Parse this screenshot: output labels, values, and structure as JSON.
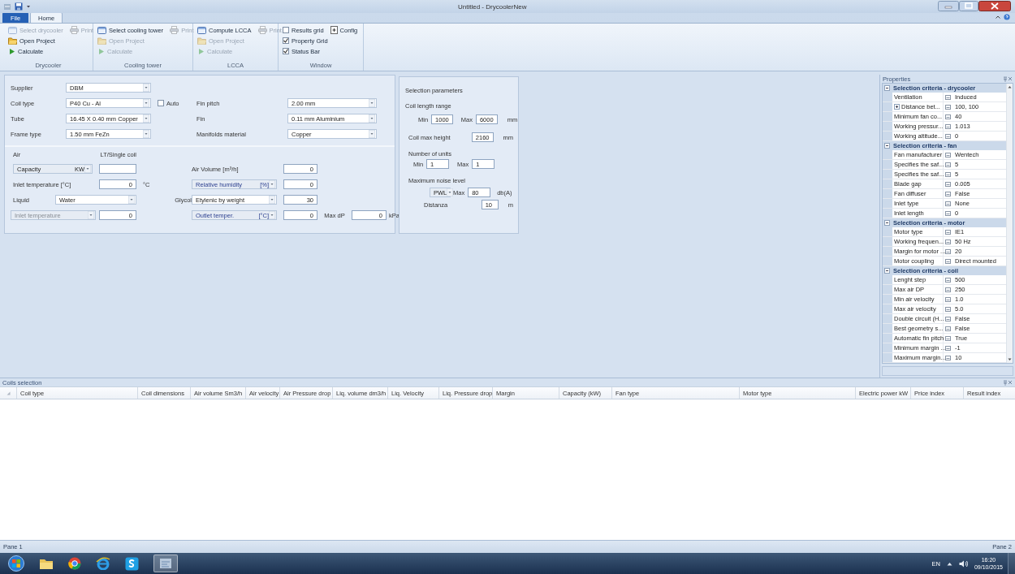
{
  "window": {
    "title": "Untitled - DrycoolerNew"
  },
  "ribbon": {
    "tabs": [
      {
        "label": "File",
        "selected": false
      },
      {
        "label": "Home",
        "selected": true
      }
    ],
    "groups": [
      {
        "label": "Drycooler",
        "rows": [
          [
            {
              "kind": "select",
              "label": "Select drycooler",
              "disabled": true
            },
            {
              "kind": "print",
              "label": "Print",
              "disabled": true
            }
          ],
          [
            {
              "kind": "open",
              "label": "Open Project",
              "disabled": false
            }
          ],
          [
            {
              "kind": "calculate",
              "label": "Calculate",
              "disabled": false
            }
          ]
        ]
      },
      {
        "label": "Cooling tower",
        "rows": [
          [
            {
              "kind": "select",
              "label": "Select cooling tower",
              "disabled": false
            },
            {
              "kind": "print",
              "label": "Print",
              "disabled": true
            }
          ],
          [
            {
              "kind": "open",
              "label": "Open Project",
              "disabled": true
            }
          ],
          [
            {
              "kind": "calculate",
              "label": "Calculate",
              "disabled": true
            }
          ]
        ]
      },
      {
        "label": "LCCA",
        "rows": [
          [
            {
              "kind": "select",
              "label": "Compute LCCA",
              "disabled": false
            },
            {
              "kind": "print",
              "label": "Print",
              "disabled": true
            }
          ],
          [
            {
              "kind": "open",
              "label": "Open Project",
              "disabled": true
            }
          ],
          [
            {
              "kind": "calculate",
              "label": "Calculate",
              "disabled": true
            }
          ]
        ]
      },
      {
        "label": "Window",
        "rows": [
          [
            {
              "kind": "check",
              "label": "Results grid",
              "checked": false,
              "disabled": false
            },
            {
              "kind": "config",
              "label": "Config",
              "disabled": false
            }
          ],
          [
            {
              "kind": "check",
              "label": "Property Grid",
              "checked": true,
              "disabled": false
            }
          ],
          [
            {
              "kind": "check",
              "label": "Status Bar",
              "checked": true,
              "disabled": false
            }
          ]
        ]
      }
    ]
  },
  "coil": {
    "supplier": {
      "label": "Supplier",
      "value": "DBM"
    },
    "left_fields": [
      {
        "label": "Coil type",
        "value": "P40 Cu - Al"
      },
      {
        "label": "Tube",
        "value": "16.45 X 0.40 mm Copper"
      },
      {
        "label": "Frame type",
        "value": "1.50 mm FeZn"
      }
    ],
    "auto": {
      "label": "Auto",
      "checked": false
    },
    "right_fields": [
      {
        "label": "Fin pitch",
        "value": "2.00 mm"
      },
      {
        "label": "Fin",
        "value": "0.11 mm Aluminium"
      },
      {
        "label": "Manifolds material",
        "value": "Copper"
      }
    ]
  },
  "conditions": {
    "air_label": "Air",
    "capacity_caption": "LT/Single coil",
    "capacity": {
      "mode": "Capacity",
      "unit": "KW"
    },
    "air_volume": {
      "label": "Air Volume [m³/h]",
      "value": "0"
    },
    "inlet_temperature": {
      "label": "Inlet temperature [°C]",
      "value": "0",
      "unit": "°C"
    },
    "relative_humidity": {
      "mode": "Relative humidity",
      "unit": "[%]",
      "value": "0"
    },
    "liquid": {
      "label": "Liquid",
      "value": "Water"
    },
    "glycol": {
      "label": "Glycol",
      "value": "Etylenic by weight",
      "amount": "30"
    },
    "liquid_inlet": {
      "mode": "Inlet temperature",
      "value": "0"
    },
    "outlet": {
      "mode": "Outlet temper.",
      "unit": "[°C]",
      "value": "0"
    },
    "max_dp": {
      "label": "Max dP",
      "value": "0",
      "unit": "kPa"
    }
  },
  "selection_parameters": {
    "title": "Selection parameters",
    "coil_length": {
      "label": "Coil length range",
      "min_label": "Min",
      "min": "1000",
      "max_label": "Max",
      "max": "6000",
      "unit": "mm"
    },
    "coil_max_height": {
      "label": "Coil max height",
      "value": "2160",
      "unit": "mm"
    },
    "units": {
      "label": "Number of units",
      "min_label": "Min",
      "min": "1",
      "max_label": "Max",
      "max": "1"
    },
    "noise": {
      "label": "Maximum noise level",
      "mode": "PWL",
      "max_label": "Max",
      "max": "80",
      "unit": "db(A)",
      "distance_label": "Distanza",
      "distance": "10",
      "distance_unit": "m"
    }
  },
  "properties": {
    "title": "Properties",
    "categories": [
      {
        "title": "Selection criteria - drycooler",
        "expanded": true,
        "rows": [
          {
            "name": "Ventilation",
            "value": "Induced",
            "expandable": false
          },
          {
            "name": "Distance bet...",
            "value": "100, 100",
            "expandable": true
          },
          {
            "name": "Minimum fan co...",
            "value": "40",
            "expandable": false
          },
          {
            "name": "Working pressur...",
            "value": "1.013",
            "expandable": false
          },
          {
            "name": "Working altitude...",
            "value": "0",
            "expandable": false
          }
        ]
      },
      {
        "title": "Selection criteria - fan",
        "expanded": true,
        "rows": [
          {
            "name": "Fan manufacturer",
            "value": "Wentech",
            "expandable": false
          },
          {
            "name": "Specifies the saf...",
            "value": "5",
            "expandable": false
          },
          {
            "name": "Specifies the saf...",
            "value": "5",
            "expandable": false
          },
          {
            "name": "Blade gap",
            "value": "0.005",
            "expandable": false
          },
          {
            "name": "Fan diffuser",
            "value": "False",
            "expandable": false
          },
          {
            "name": "Inlet type",
            "value": "None",
            "expandable": false
          },
          {
            "name": "Inlet length",
            "value": "0",
            "expandable": false
          }
        ]
      },
      {
        "title": "Selection criteria - motor",
        "expanded": true,
        "rows": [
          {
            "name": "Motor type",
            "value": "IE1",
            "expandable": false
          },
          {
            "name": "Working frequen...",
            "value": "50 Hz",
            "expandable": false
          },
          {
            "name": "Margin for motor ...",
            "value": "20",
            "expandable": false
          },
          {
            "name": "Motor coupling",
            "value": "Direct mounted",
            "expandable": false
          }
        ]
      },
      {
        "title": "Selection criteria - coil",
        "expanded": true,
        "rows": [
          {
            "name": "Lenght step",
            "value": "500",
            "expandable": false
          },
          {
            "name": "Max air DP",
            "value": "250",
            "expandable": false
          },
          {
            "name": "Min air velocity",
            "value": "1.0",
            "expandable": false
          },
          {
            "name": "Max air velocity",
            "value": "5.0",
            "expandable": false
          },
          {
            "name": "Double circuit (H...",
            "value": "False",
            "expandable": false
          },
          {
            "name": "Best geometry s...",
            "value": "False",
            "expandable": false
          },
          {
            "name": "Automatic fin pitch",
            "value": "True",
            "expandable": false
          },
          {
            "name": "Minimum margin ...",
            "value": "-1",
            "expandable": false
          },
          {
            "name": "Maximum margin...",
            "value": "10",
            "expandable": false
          }
        ]
      }
    ]
  },
  "coils_selection": {
    "title": "Coils selection",
    "columns": [
      "Coil type",
      "Coil dimensions",
      "Air volume Sm3/h",
      "Air velocity",
      "Air Pressure drop",
      "Liq. volume dm3/h",
      "Liq. Velocity",
      "Liq. Pressure drop",
      "Margin",
      "Capacity (kW)",
      "Fan type",
      "Motor type",
      "Electric power kW",
      "Price index",
      "Result index"
    ]
  },
  "status_bar": [
    "Pane 1",
    "Pane 2"
  ],
  "taskbar": {
    "language": "EN",
    "time": "16:20",
    "date": "09/10/2015"
  }
}
